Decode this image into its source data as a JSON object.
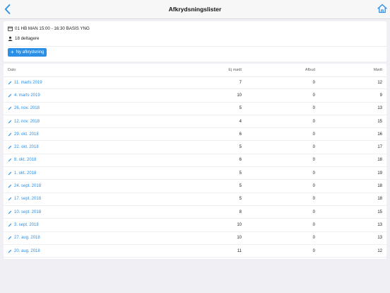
{
  "header": {
    "title": "Afkrydsningslister",
    "back_icon": "chevron-left-icon",
    "home_icon": "home-icon",
    "accent_color": "#2b8fe5"
  },
  "info": {
    "team": "01 HB MAN 15:00 - 16:30 BASIS YNG",
    "participants": "18 deltagere",
    "new_button_label": "Ny afkrydsning"
  },
  "table": {
    "headers": {
      "date": "Dato",
      "ej_modt": "Ej mødt",
      "afbud": "Afbud",
      "modt": "Mødt"
    },
    "rows": [
      {
        "date": "11. marts 2019",
        "ej_modt": "7",
        "afbud": "0",
        "modt": "12"
      },
      {
        "date": "4. marts 2019",
        "ej_modt": "10",
        "afbud": "0",
        "modt": "9"
      },
      {
        "date": "26. nov. 2018",
        "ej_modt": "5",
        "afbud": "0",
        "modt": "13"
      },
      {
        "date": "12. nov. 2018",
        "ej_modt": "4",
        "afbud": "0",
        "modt": "15"
      },
      {
        "date": "29. okt. 2018",
        "ej_modt": "6",
        "afbud": "0",
        "modt": "16"
      },
      {
        "date": "22. okt. 2018",
        "ej_modt": "5",
        "afbud": "0",
        "modt": "17"
      },
      {
        "date": "8. okt. 2018",
        "ej_modt": "6",
        "afbud": "0",
        "modt": "18"
      },
      {
        "date": "1. okt. 2018",
        "ej_modt": "5",
        "afbud": "0",
        "modt": "19"
      },
      {
        "date": "24. sept. 2018",
        "ej_modt": "5",
        "afbud": "0",
        "modt": "18"
      },
      {
        "date": "17. sept. 2018",
        "ej_modt": "5",
        "afbud": "0",
        "modt": "18"
      },
      {
        "date": "10. sept. 2018",
        "ej_modt": "8",
        "afbud": "0",
        "modt": "15"
      },
      {
        "date": "3. sept. 2018",
        "ej_modt": "10",
        "afbud": "0",
        "modt": "13"
      },
      {
        "date": "27. aug. 2018",
        "ej_modt": "10",
        "afbud": "0",
        "modt": "13"
      },
      {
        "date": "20. aug. 2018",
        "ej_modt": "11",
        "afbud": "0",
        "modt": "12"
      }
    ]
  }
}
